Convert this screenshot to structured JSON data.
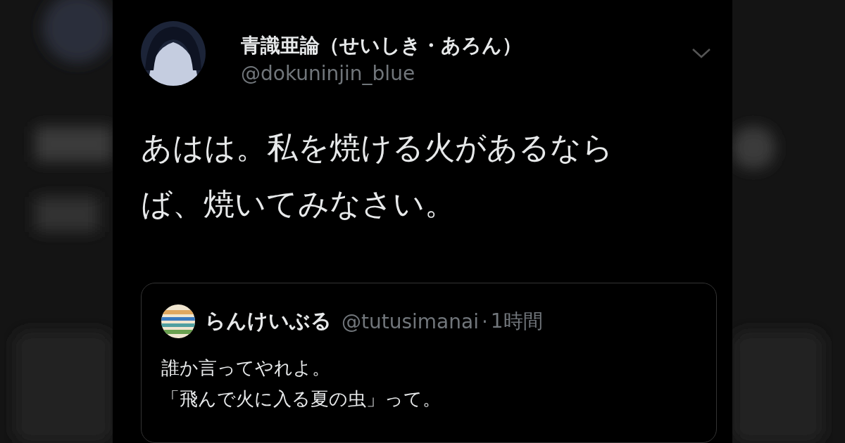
{
  "tweet": {
    "author_name": "青識亜論（せいしき・あろん）",
    "author_handle": "@dokuninjin_blue",
    "text": "あはは。私を焼ける火があるならば、焼いてみなさい。"
  },
  "quoted_tweet": {
    "author_name": "らんけいぶる",
    "author_handle": "@tutusimanai",
    "separator": "·",
    "time": "1時間",
    "text_lines": [
      "誰か言ってやれよ。",
      "「飛んで火に入る夏の虫」って。"
    ]
  }
}
